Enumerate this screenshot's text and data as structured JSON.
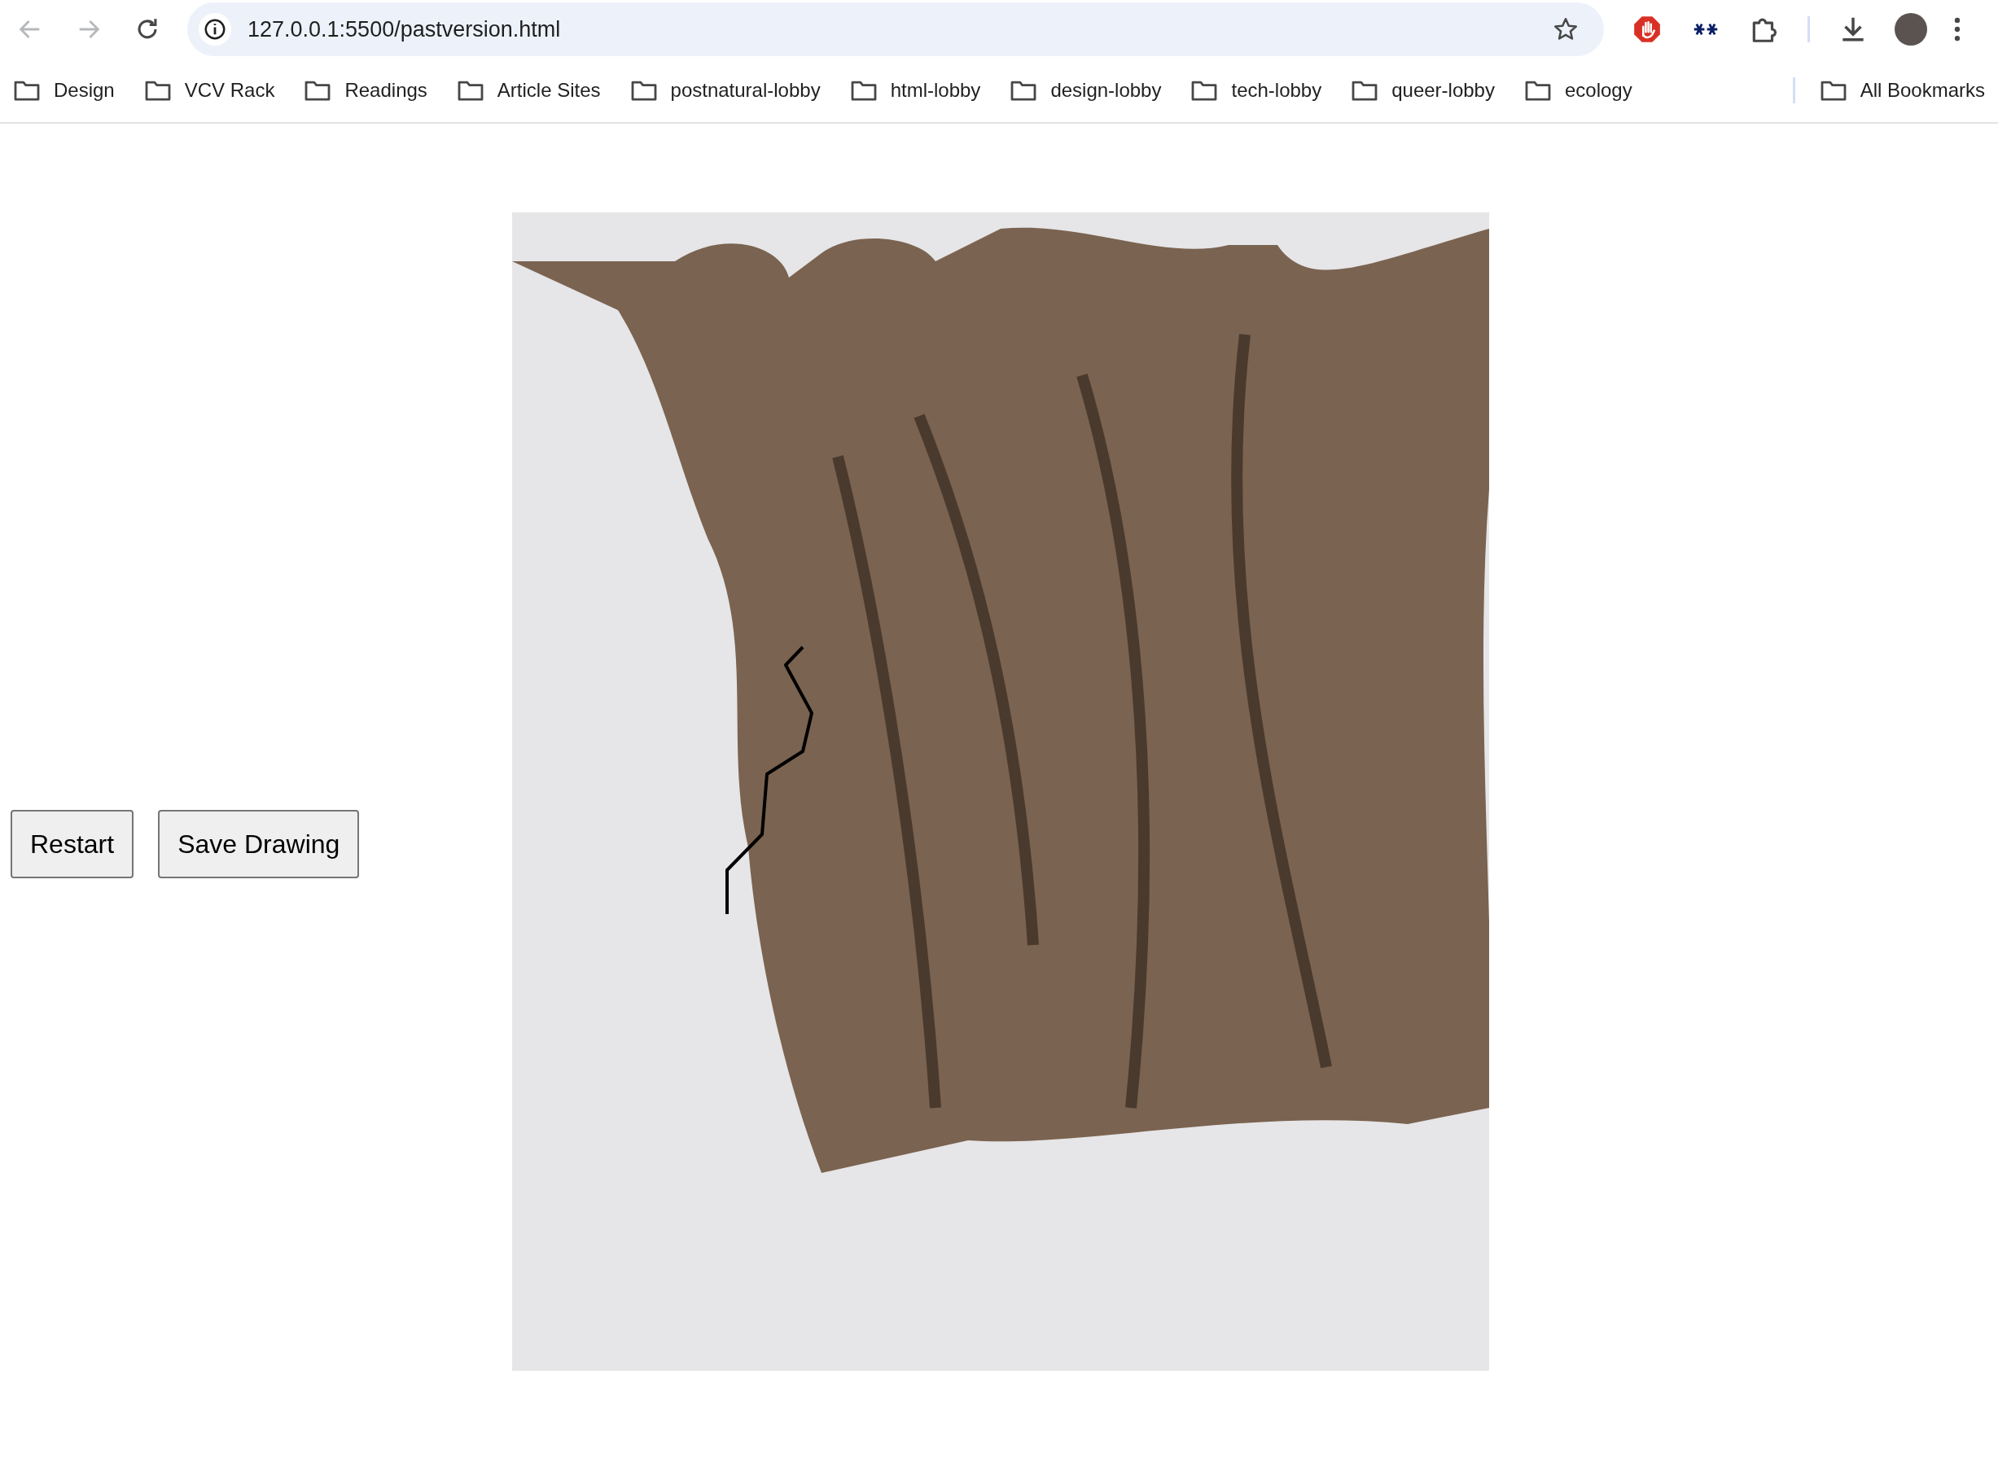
{
  "browser": {
    "url": "127.0.0.1:5500/pastversion.html",
    "bookmarks": [
      {
        "label": "Design"
      },
      {
        "label": "VCV Rack"
      },
      {
        "label": "Readings"
      },
      {
        "label": "Article Sites"
      },
      {
        "label": "postnatural-lobby"
      },
      {
        "label": "html-lobby"
      },
      {
        "label": "design-lobby"
      },
      {
        "label": "tech-lobby"
      },
      {
        "label": "queer-lobby"
      },
      {
        "label": "ecology"
      }
    ],
    "all_bookmarks": "All Bookmarks"
  },
  "controls": {
    "buttons": [
      {
        "label": "Restart"
      },
      {
        "label": "Save Drawing"
      }
    ]
  }
}
